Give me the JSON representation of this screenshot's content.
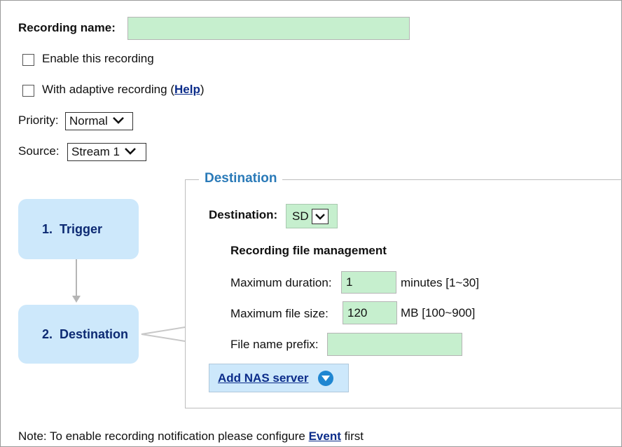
{
  "form": {
    "recording_name_label": "Recording name:",
    "recording_name_value": "",
    "enable_label": "Enable this recording",
    "adaptive_label_prefix": "With adaptive recording (",
    "adaptive_help_link": "Help",
    "adaptive_label_suffix": ")",
    "priority_label": "Priority:",
    "priority_value": "Normal",
    "source_label": "Source:",
    "source_value": "Stream 1"
  },
  "steps": [
    {
      "label": "1.  Trigger"
    },
    {
      "label": "2.  Destination"
    }
  ],
  "destination": {
    "legend": "Destination",
    "destination_label": "Destination:",
    "destination_value": "SD",
    "file_mgmt_title": "Recording file management",
    "max_duration_label": "Maximum duration:",
    "max_duration_value": "1",
    "max_duration_unit": "minutes [1~30]",
    "max_filesize_label": "Maximum file size:",
    "max_filesize_value": "120",
    "max_filesize_unit": "MB [100~900]",
    "prefix_label": "File name prefix:",
    "prefix_value": "",
    "add_nas_label": "Add NAS server"
  },
  "note": {
    "prefix": "Note: To enable recording notification please configure ",
    "link": "Event",
    "suffix": " first"
  },
  "colors": {
    "input_bg": "#c6efce",
    "step_bg": "#cde8fb",
    "legend_text": "#2a7ab8",
    "link_text": "#0b2c8a",
    "nas_icon": "#1f86d1"
  },
  "icons": [
    "chevron-down-icon",
    "circle-down-arrow-icon"
  ]
}
